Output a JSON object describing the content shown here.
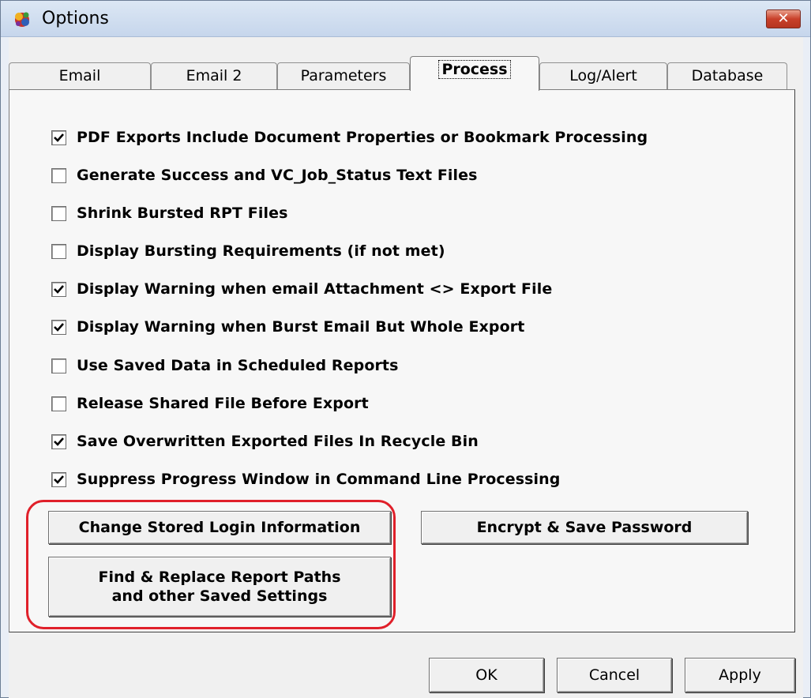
{
  "window": {
    "title": "Options",
    "close_label": "✕"
  },
  "tabs": [
    {
      "label": "Email",
      "active": false
    },
    {
      "label": "Email 2",
      "active": false
    },
    {
      "label": "Parameters",
      "active": false
    },
    {
      "label": "Process",
      "active": true
    },
    {
      "label": "Log/Alert",
      "active": false
    },
    {
      "label": "Database",
      "active": false
    }
  ],
  "options": [
    {
      "label": "PDF Exports Include Document Properties or Bookmark Processing",
      "checked": true
    },
    {
      "label": "Generate Success and VC_Job_Status Text Files",
      "checked": false
    },
    {
      "label": "Shrink Bursted RPT Files",
      "checked": false
    },
    {
      "label": "Display Bursting Requirements (if not met)",
      "checked": false
    },
    {
      "label": "Display Warning when email Attachment <> Export File",
      "checked": true
    },
    {
      "label": "Display Warning when Burst Email But Whole Export",
      "checked": true
    },
    {
      "label": "Use Saved Data in Scheduled Reports",
      "checked": false
    },
    {
      "label": "Release Shared File Before Export",
      "checked": false
    },
    {
      "label": "Save Overwritten Exported Files In Recycle Bin",
      "checked": true
    },
    {
      "label": "Suppress Progress Window in Command Line Processing",
      "checked": true
    }
  ],
  "buttons": {
    "change_login": "Change Stored Login Information",
    "encrypt_password": "Encrypt & Save Password",
    "find_replace_line1": "Find & Replace Report Paths",
    "find_replace_line2": "and other Saved Settings",
    "ok": "OK",
    "cancel": "Cancel",
    "apply": "Apply"
  },
  "colors": {
    "highlight_outline": "#e0202a",
    "close_button": "#c8402a"
  }
}
